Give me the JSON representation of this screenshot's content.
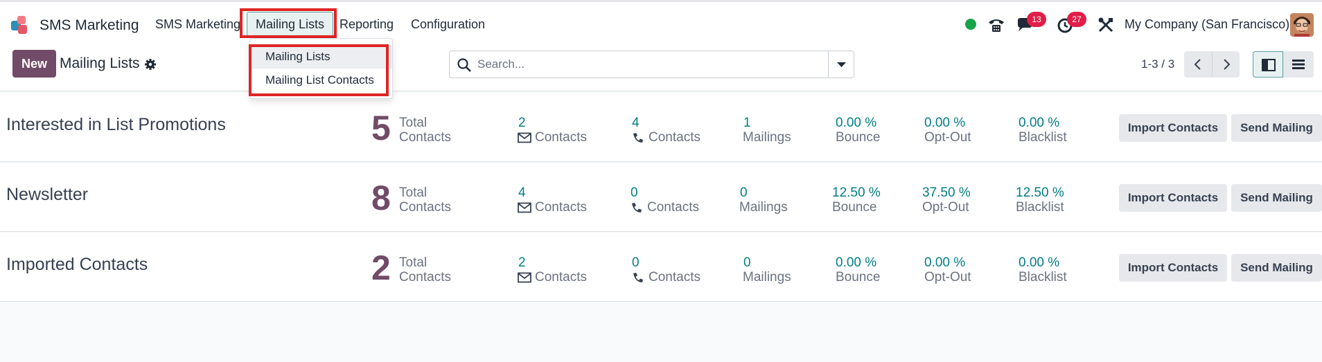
{
  "navbar": {
    "app_name": "SMS Marketing",
    "menus": [
      "SMS Marketing",
      "Mailing Lists",
      "Reporting",
      "Configuration"
    ],
    "active_menu": "Mailing Lists",
    "chat_badge": "13",
    "activity_badge": "27",
    "company": "My Company (San Francisco)"
  },
  "dropdown": {
    "items": [
      "Mailing Lists",
      "Mailing List Contacts"
    ]
  },
  "control": {
    "new_label": "New",
    "title": "Mailing Lists",
    "search_placeholder": "Search...",
    "pager": "1-3 / 3"
  },
  "labels": {
    "total_line1": "Total",
    "total_line2": "Contacts",
    "contacts": "Contacts",
    "mailings": "Mailings",
    "bounce": "Bounce",
    "optout": "Opt-Out",
    "blacklist": "Blacklist",
    "import_btn": "Import Contacts",
    "send_btn": "Send Mailing"
  },
  "records": [
    {
      "name": "Interested in List Promotions",
      "total": "5",
      "email_contacts": "2",
      "phone_contacts": "4",
      "mailings": "1",
      "bounce": "0.00 %",
      "optout": "0.00 %",
      "blacklist": "0.00 %"
    },
    {
      "name": "Newsletter",
      "total": "8",
      "email_contacts": "4",
      "phone_contacts": "0",
      "mailings": "0",
      "bounce": "12.50 %",
      "optout": "37.50 %",
      "blacklist": "12.50 %"
    },
    {
      "name": "Imported Contacts",
      "total": "2",
      "email_contacts": "2",
      "phone_contacts": "0",
      "mailings": "0",
      "bounce": "0.00 %",
      "optout": "0.00 %",
      "blacklist": "0.00 %"
    }
  ],
  "colors": {
    "brand": "#714b67",
    "accent": "#017e84",
    "badge": "#e11d48",
    "online": "#16a34a",
    "highlight": "#e02424"
  }
}
